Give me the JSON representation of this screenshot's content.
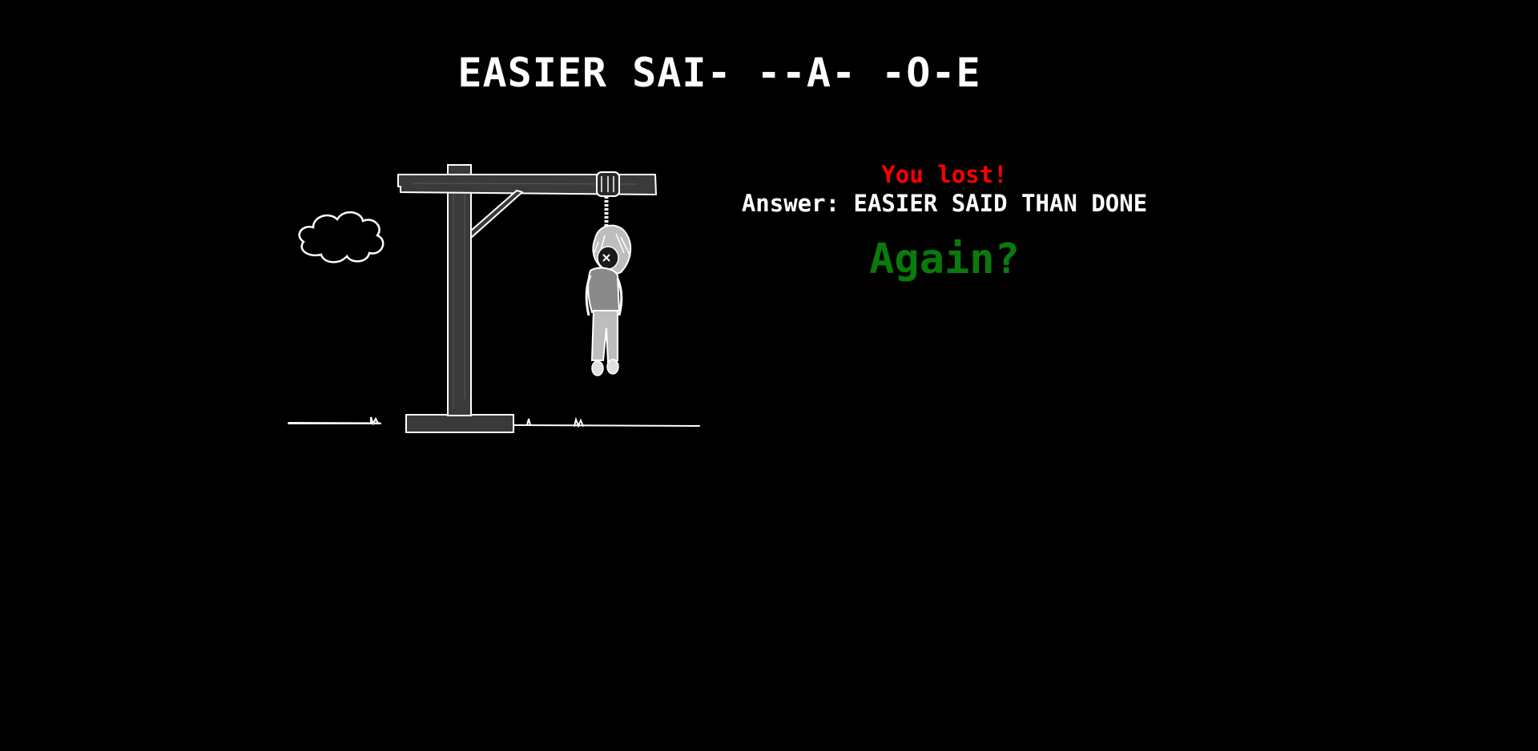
{
  "puzzle": {
    "masked_phrase": "EASIER SAI- --A- -O-E"
  },
  "result": {
    "status_text": "You lost!",
    "answer_label": "Answer:",
    "answer_value": "EASIER SAID THAN DONE",
    "again_label": "Again?"
  },
  "colors": {
    "background": "#000000",
    "text": "#ffffff",
    "lost": "#ff0000",
    "again": "#0a7a0a"
  },
  "drawing": {
    "stage": "complete",
    "icons": [
      "gallows-icon",
      "cloud-icon",
      "hanged-man-icon",
      "grass-icon"
    ]
  }
}
